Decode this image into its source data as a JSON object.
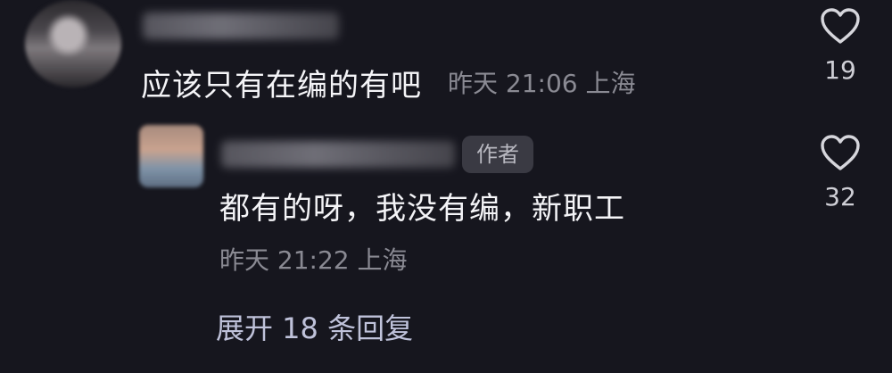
{
  "main_comment": {
    "text": "应该只有在编的有吧",
    "meta": "昨天 21:06 上海",
    "like_count": "19",
    "like_icon": "heart-outline-icon"
  },
  "reply": {
    "author_badge": "作者",
    "text": "都有的呀，我没有编，新职工",
    "meta": "昨天 21:22 上海",
    "like_count": "32",
    "like_icon": "heart-outline-icon"
  },
  "expand_replies": "展开 18 条回复",
  "colors": {
    "background": "#16161e",
    "text": "#f4f4f7",
    "meta": "#8a8a93",
    "link": "#bfc2da",
    "badge_bg": "#3a3a43"
  }
}
